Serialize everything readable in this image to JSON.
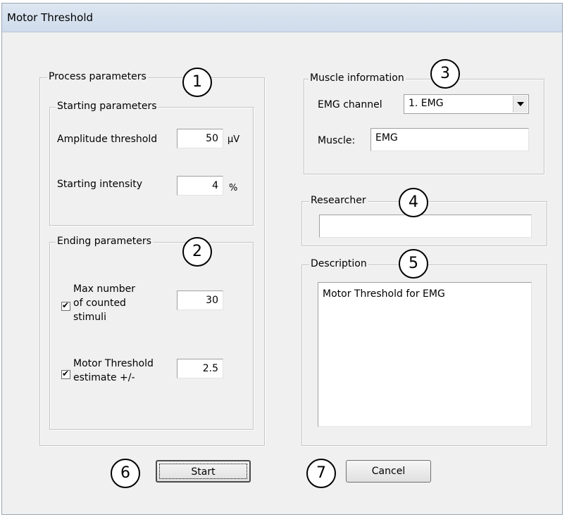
{
  "window": {
    "title": "Motor Threshold"
  },
  "process": {
    "label": "Process parameters",
    "badge": "1",
    "starting": {
      "label": "Starting parameters",
      "amplitude_label": "Amplitude threshold",
      "amplitude_value": "50",
      "amplitude_unit": "µV",
      "intensity_label": "Starting intensity",
      "intensity_value": "4",
      "intensity_unit": "%"
    },
    "ending": {
      "label": "Ending parameters",
      "badge": "2",
      "max_stimuli_lines": [
        "Max number",
        "of counted",
        "stimuli"
      ],
      "max_stimuli_checked": true,
      "max_stimuli_value": "30",
      "mt_estimate_lines": [
        "Motor Threshold",
        "estimate +/-"
      ],
      "mt_estimate_checked": true,
      "mt_estimate_value": "2.5"
    }
  },
  "muscle": {
    "label": "Muscle information",
    "badge": "3",
    "channel_label": "EMG channel",
    "channel_value": "1. EMG",
    "muscle_label": "Muscle:",
    "muscle_value": "EMG"
  },
  "researcher": {
    "label": "Researcher",
    "badge": "4",
    "value": ""
  },
  "description": {
    "label": "Description",
    "badge": "5",
    "value": "Motor Threshold for EMG"
  },
  "buttons": {
    "start_label": "Start",
    "start_badge": "6",
    "cancel_label": "Cancel",
    "cancel_badge": "7"
  }
}
